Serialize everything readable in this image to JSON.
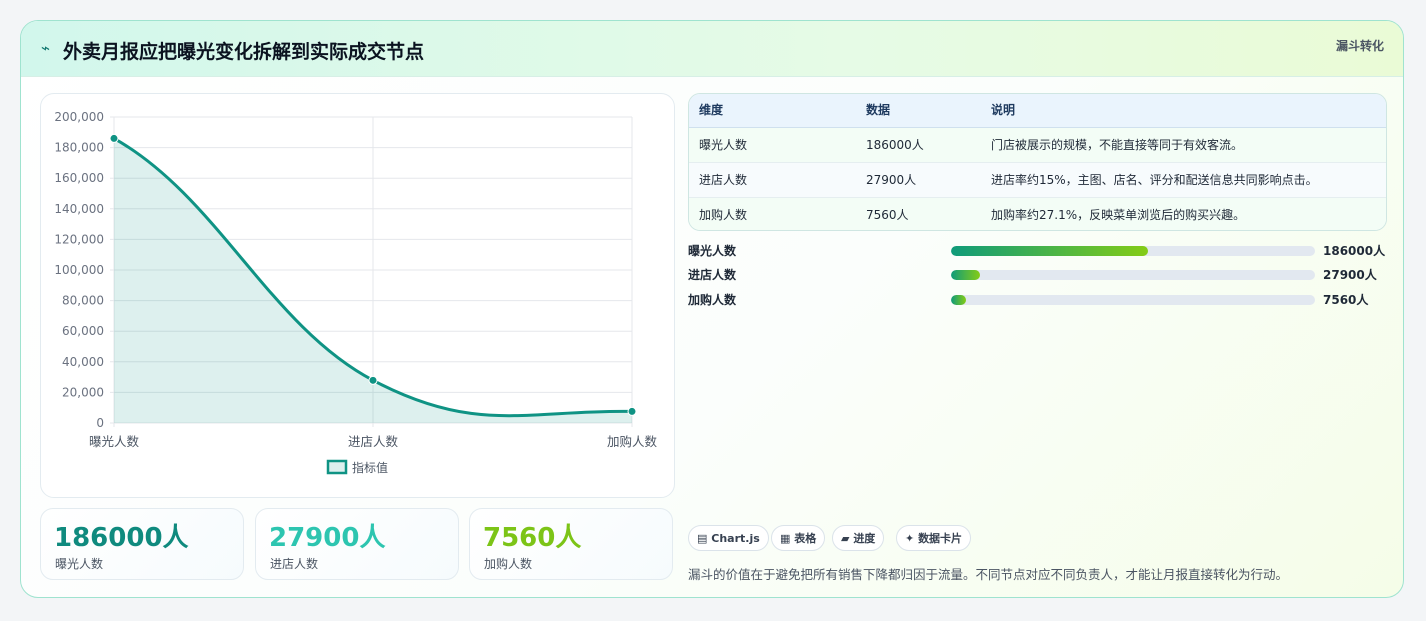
{
  "header": {
    "title": "外卖月报应把曝光变化拆解到实际成交节点",
    "tag": "漏斗转化",
    "icon": "sparkle-icon"
  },
  "chart_data": {
    "type": "line",
    "categories": [
      "曝光人数",
      "进店人数",
      "加购人数"
    ],
    "series": [
      {
        "name": "指标值",
        "values": [
          186000,
          27900,
          7560
        ],
        "color": "#0f9384",
        "fill": "area"
      }
    ],
    "ylim": [
      0,
      200000
    ],
    "yticks": [
      "200,000",
      "180,000",
      "160,000",
      "140,000",
      "120,000",
      "100,000",
      "80,000",
      "60,000",
      "40,000",
      "20,000",
      "0"
    ],
    "grid": true,
    "legend": "bottom"
  },
  "kpis": [
    {
      "value": "186000人",
      "label": "曝光人数",
      "color": "#0f8a7e"
    },
    {
      "value": "27900人",
      "label": "进店人数",
      "color": "#2dc5b0"
    },
    {
      "value": "7560人",
      "label": "加购人数",
      "color": "#7cc417"
    }
  ],
  "table": {
    "headers": [
      "维度",
      "数据",
      "说明"
    ],
    "rows": [
      [
        "曝光人数",
        "186000人",
        "门店被展示的规模，不能直接等同于有效客流。"
      ],
      [
        "进店人数",
        "27900人",
        "进店率约15%，主图、店名、评分和配送信息共同影响点击。"
      ],
      [
        "加购人数",
        "7560人",
        "加购率约27.1%，反映菜单浏览后的购买兴趣。"
      ]
    ]
  },
  "progress": [
    {
      "label": "曝光人数",
      "value": "186000人",
      "fraction": 0.54
    },
    {
      "label": "进店人数",
      "value": "27900人",
      "fraction": 0.08
    },
    {
      "label": "加购人数",
      "value": "7560人",
      "fraction": 0.04
    }
  ],
  "chips": [
    {
      "icon": "▤",
      "label": "Chart.js"
    },
    {
      "icon": "▦",
      "label": "表格"
    },
    {
      "icon": "▰",
      "label": "进度"
    },
    {
      "icon": "✦",
      "label": "数据卡片"
    }
  ],
  "footnote": "漏斗的价值在于避免把所有销售下降都归因于流量。不同节点对应不同负责人，才能让月报直接转化为行动。"
}
